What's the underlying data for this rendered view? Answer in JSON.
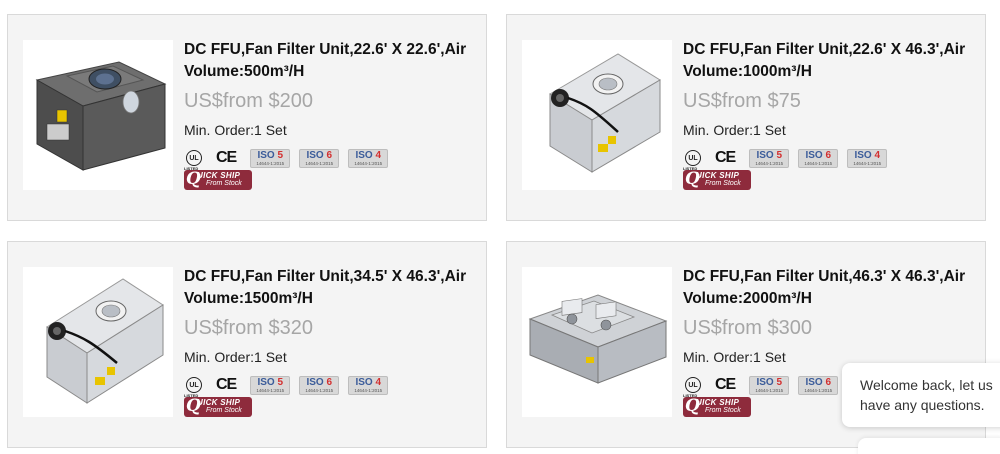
{
  "products": [
    {
      "title": "DC FFU,Fan Filter Unit,22.6' X 22.6',Air Volume:500m³/H",
      "price": "US$from $200",
      "min_order": "Min. Order:1 Set",
      "image_icon": "ffu-dark-single-fan-image"
    },
    {
      "title": "DC FFU,Fan Filter Unit,22.6' X 46.3',Air Volume:1000m³/H",
      "price": "US$from $75",
      "min_order": "Min. Order:1 Set",
      "image_icon": "ffu-white-single-fan-image"
    },
    {
      "title": "DC FFU,Fan Filter Unit,34.5' X 46.3',Air Volume:1500m³/H",
      "price": "US$from $320",
      "min_order": "Min. Order:1 Set",
      "image_icon": "ffu-white-single-fan-image"
    },
    {
      "title": "DC FFU,Fan Filter Unit,46.3' X 46.3',Air Volume:2000m³/H",
      "price": "US$from $300",
      "min_order": "Min. Order:1 Set",
      "image_icon": "ffu-double-fan-image"
    }
  ],
  "certs": {
    "ul_label": "UL",
    "ul_sub": "LISTED",
    "ce_label": "CE",
    "iso_prefix": "ISO",
    "iso_items": [
      "5",
      "6",
      "4"
    ],
    "iso_sub": "14644-1:2015"
  },
  "quick_ship": {
    "q": "Q",
    "line1": "UICK SHIP",
    "line2": "From Stock"
  },
  "chat": {
    "message": "Welcome back, let us have any questions."
  },
  "colors": {
    "card_bg": "#f4f4f4",
    "price": "#a6a6a6",
    "quick_ship_bg": "#8e2b3c",
    "iso_blue": "#3b5c9a",
    "iso_red": "#d32f2f"
  }
}
